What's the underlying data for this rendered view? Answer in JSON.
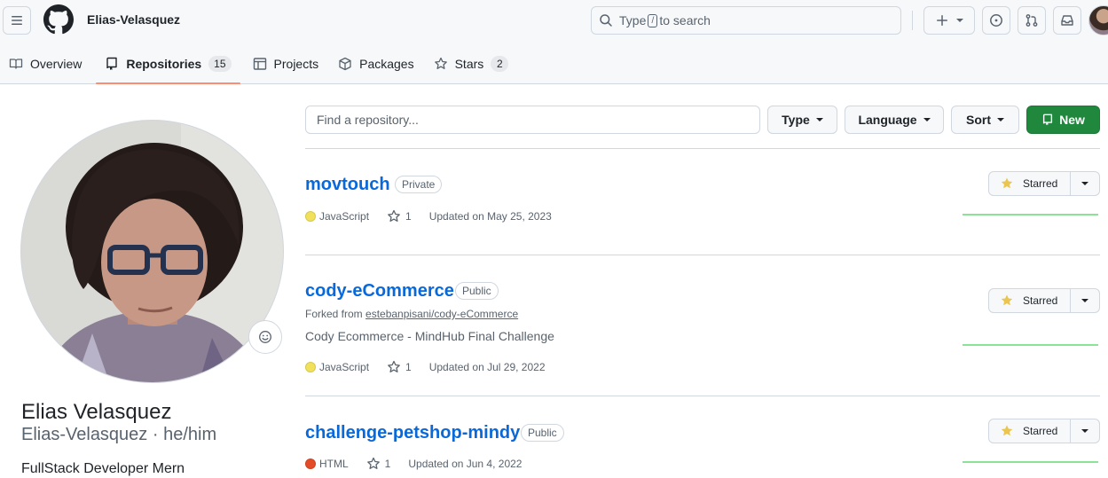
{
  "header": {
    "username": "Elias-Velasquez",
    "search": {
      "before": "Type",
      "key": "/",
      "after": "to search"
    }
  },
  "tabs": [
    {
      "label": "Overview"
    },
    {
      "label": "Repositories",
      "count": "15",
      "selected": true
    },
    {
      "label": "Projects"
    },
    {
      "label": "Packages"
    },
    {
      "label": "Stars",
      "count": "2"
    }
  ],
  "profile": {
    "name": "Elias Velasquez",
    "handle": "Elias-Velasquez · he/him",
    "bio": "FullStack Developer Mern"
  },
  "filters": {
    "search_placeholder": "Find a repository...",
    "type_label": "Type",
    "language_label": "Language",
    "sort_label": "Sort",
    "new_label": "New"
  },
  "repos": [
    {
      "name": "movtouch",
      "visibility": "Private",
      "language": "JavaScript",
      "language_color": "#f1e05a",
      "stars": "1",
      "updated": "Updated on May 25, 2023",
      "star_button": "Starred"
    },
    {
      "name": "cody-eCommerce",
      "visibility": "Public",
      "forked_prefix": "Forked from",
      "forked_from": "estebanpisani/cody-eCommerce",
      "description": "Cody Ecommerce - MindHub Final Challenge",
      "language": "JavaScript",
      "language_color": "#f1e05a",
      "stars": "1",
      "updated": "Updated on Jul 29, 2022",
      "star_button": "Starred"
    },
    {
      "name": "challenge-petshop-mindy",
      "visibility": "Public",
      "language": "HTML",
      "language_color": "#e34c26",
      "stars": "1",
      "updated": "Updated on Jun 4, 2022",
      "star_button": "Starred"
    }
  ],
  "colors": {
    "accent_tab": "#fd8c73",
    "link": "#0969da",
    "new_button": "#1f883d",
    "star_icon": "#eac54f",
    "activity_line": "#8be395"
  },
  "icons": [
    "hamburger-icon",
    "github-logo",
    "search-icon",
    "plus-icon",
    "issues-icon",
    "pull-request-icon",
    "inbox-icon",
    "book-icon",
    "repo-icon",
    "table-icon",
    "package-icon",
    "star-icon",
    "smiley-icon"
  ]
}
